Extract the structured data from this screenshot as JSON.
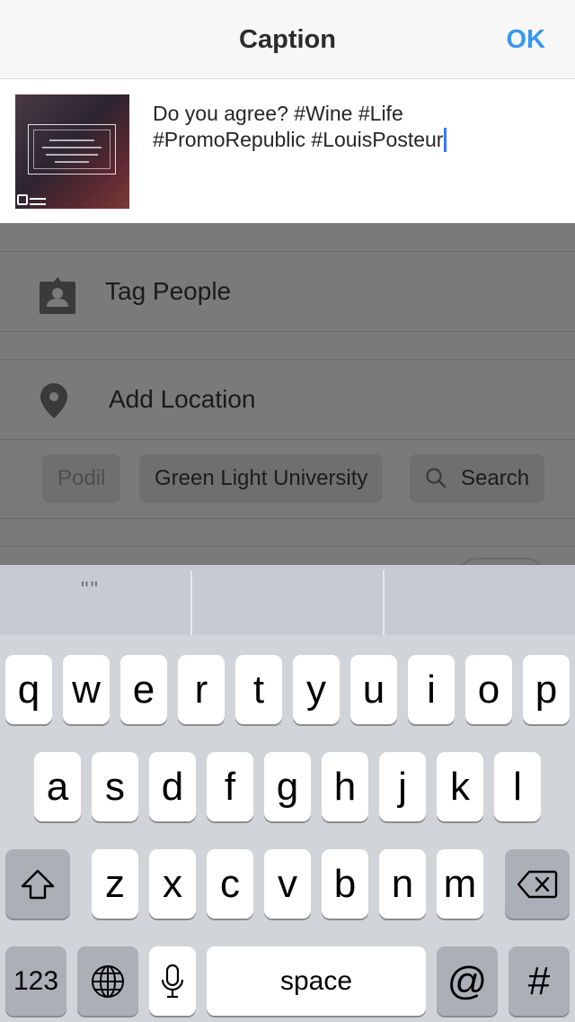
{
  "nav": {
    "title": "Caption",
    "ok_label": "OK"
  },
  "composer": {
    "caption_line1": "Do you agree? #Wine #Life",
    "caption_line2": "#PromoRepublic #LouisPosteur"
  },
  "options": {
    "tag_people": "Tag People",
    "add_location": "Add Location",
    "location_chips": [
      "Podil",
      "Green Light University"
    ],
    "search_label": "Search"
  },
  "keyboard": {
    "suggestion": "\"\"",
    "row1": [
      "q",
      "w",
      "e",
      "r",
      "t",
      "y",
      "u",
      "i",
      "o",
      "p"
    ],
    "row2": [
      "a",
      "s",
      "d",
      "f",
      "g",
      "h",
      "j",
      "k",
      "l"
    ],
    "row3": [
      "z",
      "x",
      "c",
      "v",
      "b",
      "n",
      "m"
    ],
    "numbers_label": "123",
    "space_label": "space",
    "at_label": "@",
    "hash_label": "#"
  },
  "colors": {
    "accent": "#3898f0",
    "cursor": "#3478f6"
  }
}
